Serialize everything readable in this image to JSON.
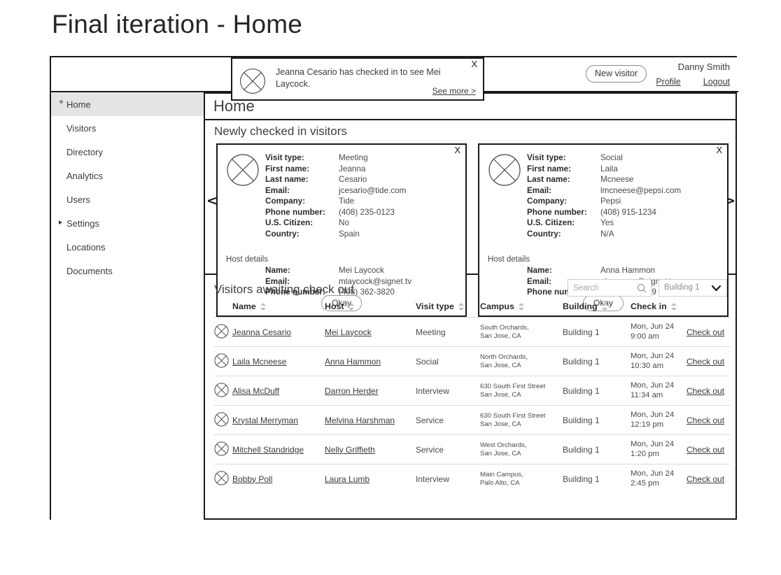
{
  "slide": {
    "title": "Final iteration - Home"
  },
  "header": {
    "new_visitor_label": "New visitor",
    "user_name": "Danny Smith",
    "profile_label": "Profile",
    "logout_label": "Logout"
  },
  "toast": {
    "message": "Jeanna Cesario has checked in to see Mei Laycock.",
    "see_more_label": "See more >",
    "close_label": "X",
    "avatar_icon": "circle-x-avatar-icon"
  },
  "sidebar": {
    "items": [
      {
        "label": "Home",
        "active": true,
        "marker": "bullet"
      },
      {
        "label": "Visitors",
        "active": false,
        "marker": "none"
      },
      {
        "label": "Directory",
        "active": false,
        "marker": "none"
      },
      {
        "label": "Analytics",
        "active": false,
        "marker": "none"
      },
      {
        "label": "Users",
        "active": false,
        "marker": "none"
      },
      {
        "label": "Settings",
        "active": false,
        "marker": "triangle"
      },
      {
        "label": "Locations",
        "active": false,
        "marker": "none"
      },
      {
        "label": "Documents",
        "active": false,
        "marker": "none"
      }
    ]
  },
  "page": {
    "title": "Home",
    "carousel_section_title": "Newly checked in visitors",
    "prev_arrow": "<",
    "next_arrow": ">"
  },
  "field_labels": {
    "visit_type": "Visit type:",
    "first_name": "First name:",
    "last_name": "Last name:",
    "email": "Email:",
    "company": "Company:",
    "phone": "Phone number:",
    "citizen": "U.S. Citizen:",
    "country": "Country:",
    "host_details": "Host details",
    "host_name": "Name:",
    "host_email": "Email:",
    "host_phone": "Phone number:",
    "okay": "Okay",
    "close": "X"
  },
  "cards": [
    {
      "visit_type": "Meeting",
      "first_name": "Jeanna",
      "last_name": "Cesario",
      "email": "jcesario@tide.com",
      "company": "Tide",
      "phone": "(408) 235-0123",
      "citizen": "No",
      "country": "Spain",
      "host_name": "Mei Laycock",
      "host_email": "mlaycock@signet.tv",
      "host_phone": "(408) 362-3820"
    },
    {
      "visit_type": "Social",
      "first_name": "Laila",
      "last_name": "Mcneese",
      "email": "lmcneese@pepsi.com",
      "company": "Pepsi",
      "phone": "(408) 915-1234",
      "citizen": "Yes",
      "country": "N/A",
      "host_name": "Anna Hammon",
      "host_email": "ahammon@signet.tv",
      "host_phone": "(408) 263-0439"
    }
  ],
  "table": {
    "title": "Visitors awaiting check out",
    "search_placeholder": "Search",
    "search_value": "",
    "building_filter": "Building 1",
    "columns": [
      "Name",
      "Host",
      "Visit type",
      "Campus",
      "Building",
      "Check in"
    ],
    "action_label": "Check out",
    "rows": [
      {
        "name": "Jeanna Cesario",
        "host": "Mei Laycock",
        "visit_type": "Meeting",
        "campus_line1": "South Orchards,",
        "campus_line2": "San Jose, CA",
        "building": "Building 1",
        "checkin_date": "Mon, Jun 24",
        "checkin_time": "9:00 am"
      },
      {
        "name": "Laila Mcneese",
        "host": "Anna Hammon",
        "visit_type": "Social",
        "campus_line1": "North Orchards,",
        "campus_line2": "San Jose, CA",
        "building": "Building 1",
        "checkin_date": "Mon, Jun 24",
        "checkin_time": "10:30 am"
      },
      {
        "name": "Alisa McDuff",
        "host": "Darron Herder",
        "visit_type": "Interview",
        "campus_line1": "630 South First Street",
        "campus_line2": "San Jose, CA",
        "building": "Building 1",
        "checkin_date": "Mon, Jun 24",
        "checkin_time": "11:34 am"
      },
      {
        "name": "Krystal Merryman",
        "host": "Melvina Harshman",
        "visit_type": "Service",
        "campus_line1": "630 South First Street",
        "campus_line2": "San Jose, CA",
        "building": "Building 1",
        "checkin_date": "Mon, Jun 24",
        "checkin_time": "12:19 pm"
      },
      {
        "name": "Mitchell Standridge",
        "host": "Nelly Griffieth",
        "visit_type": "Service",
        "campus_line1": "West Orchards,",
        "campus_line2": "San Jose, CA",
        "building": "Building 1",
        "checkin_date": "Mon, Jun 24",
        "checkin_time": "1:20 pm"
      },
      {
        "name": "Bobby Poll",
        "host": "Laura Lumb",
        "visit_type": "Interview",
        "campus_line1": "Main Campus,",
        "campus_line2": "Palo Alto, CA",
        "building": "Building 1",
        "checkin_date": "Mon, Jun 24",
        "checkin_time": "2:45 pm"
      }
    ]
  }
}
